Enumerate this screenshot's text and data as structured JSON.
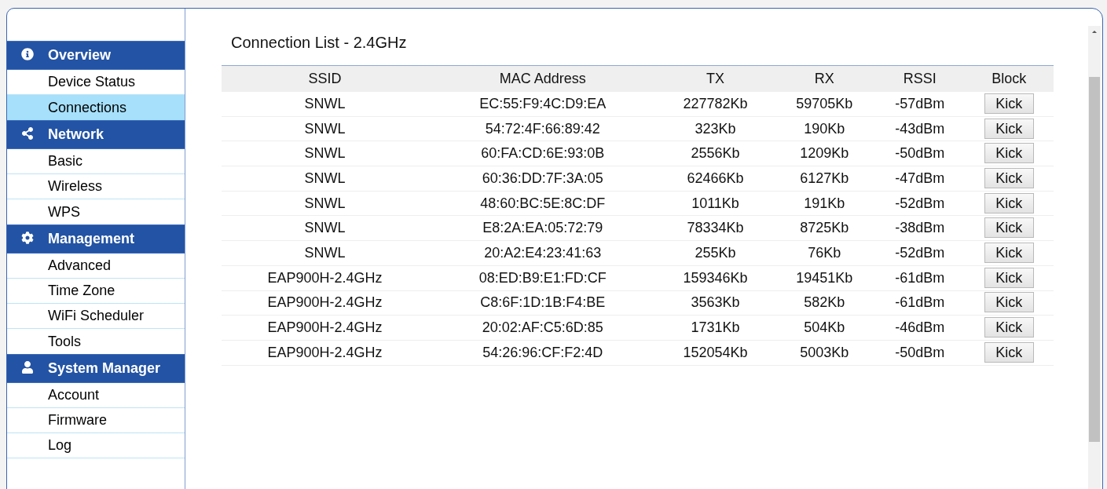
{
  "sidebar": {
    "sections": [
      {
        "title": "Overview",
        "kind": "info",
        "items": [
          {
            "label": "Device Status",
            "selected": false
          },
          {
            "label": "Connections",
            "selected": true
          }
        ]
      },
      {
        "title": "Network",
        "kind": "share",
        "items": [
          {
            "label": "Basic",
            "selected": false
          },
          {
            "label": "Wireless",
            "selected": false
          },
          {
            "label": "WPS",
            "selected": false
          }
        ]
      },
      {
        "title": "Management",
        "kind": "gear",
        "items": [
          {
            "label": "Advanced",
            "selected": false
          },
          {
            "label": "Time Zone",
            "selected": false
          },
          {
            "label": "WiFi Scheduler",
            "selected": false
          },
          {
            "label": "Tools",
            "selected": false
          }
        ]
      },
      {
        "title": "System Manager",
        "kind": "user",
        "items": [
          {
            "label": "Account",
            "selected": false
          },
          {
            "label": "Firmware",
            "selected": false
          },
          {
            "label": "Log",
            "selected": false
          }
        ]
      }
    ]
  },
  "content": {
    "title": "Connection List - 2.4GHz",
    "table": {
      "columns": [
        "SSID",
        "MAC Address",
        "TX",
        "RX",
        "RSSI",
        "Block"
      ],
      "rows": [
        {
          "ssid": "SNWL",
          "mac": "EC:55:F9:4C:D9:EA",
          "tx": "227782Kb",
          "rx": "59705Kb",
          "rssi": "-57dBm",
          "action": "Kick"
        },
        {
          "ssid": "SNWL",
          "mac": "54:72:4F:66:89:42",
          "tx": "323Kb",
          "rx": "190Kb",
          "rssi": "-43dBm",
          "action": "Kick"
        },
        {
          "ssid": "SNWL",
          "mac": "60:FA:CD:6E:93:0B",
          "tx": "2556Kb",
          "rx": "1209Kb",
          "rssi": "-50dBm",
          "action": "Kick"
        },
        {
          "ssid": "SNWL",
          "mac": "60:36:DD:7F:3A:05",
          "tx": "62466Kb",
          "rx": "6127Kb",
          "rssi": "-47dBm",
          "action": "Kick"
        },
        {
          "ssid": "SNWL",
          "mac": "48:60:BC:5E:8C:DF",
          "tx": "1011Kb",
          "rx": "191Kb",
          "rssi": "-52dBm",
          "action": "Kick"
        },
        {
          "ssid": "SNWL",
          "mac": "E8:2A:EA:05:72:79",
          "tx": "78334Kb",
          "rx": "8725Kb",
          "rssi": "-38dBm",
          "action": "Kick"
        },
        {
          "ssid": "SNWL",
          "mac": "20:A2:E4:23:41:63",
          "tx": "255Kb",
          "rx": "76Kb",
          "rssi": "-52dBm",
          "action": "Kick"
        },
        {
          "ssid": "EAP900H-2.4GHz",
          "mac": "08:ED:B9:E1:FD:CF",
          "tx": "159346Kb",
          "rx": "19451Kb",
          "rssi": "-61dBm",
          "action": "Kick"
        },
        {
          "ssid": "EAP900H-2.4GHz",
          "mac": "C8:6F:1D:1B:F4:BE",
          "tx": "3563Kb",
          "rx": "582Kb",
          "rssi": "-61dBm",
          "action": "Kick"
        },
        {
          "ssid": "EAP900H-2.4GHz",
          "mac": "20:02:AF:C5:6D:85",
          "tx": "1731Kb",
          "rx": "504Kb",
          "rssi": "-46dBm",
          "action": "Kick"
        },
        {
          "ssid": "EAP900H-2.4GHz",
          "mac": "54:26:96:CF:F2:4D",
          "tx": "152054Kb",
          "rx": "5003Kb",
          "rssi": "-50dBm",
          "action": "Kick"
        }
      ]
    }
  }
}
